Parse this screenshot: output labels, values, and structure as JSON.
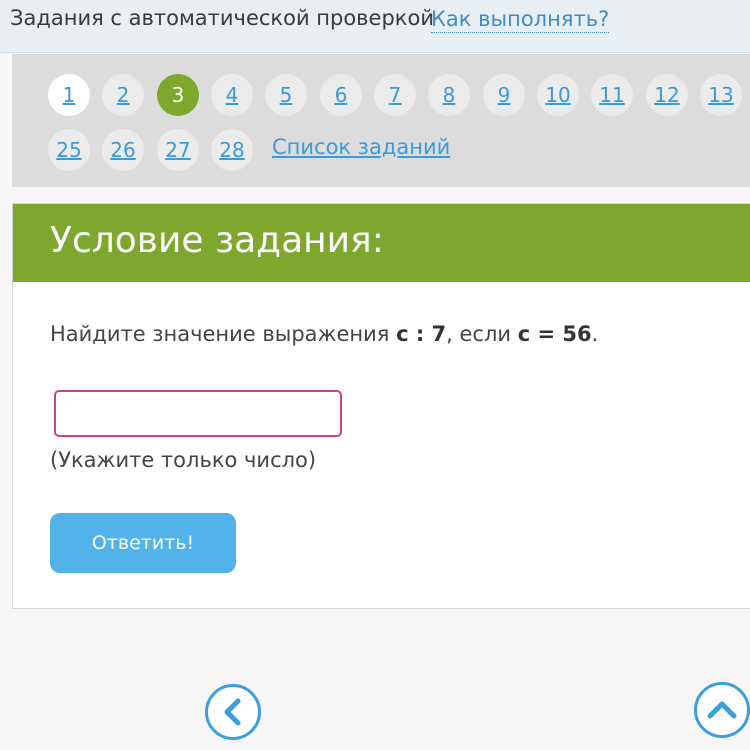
{
  "header": {
    "title": "Задания с автоматической проверкой",
    "howto_link": "Как выполнять?"
  },
  "nav": {
    "row1": [
      {
        "label": "1",
        "state": "visited"
      },
      {
        "label": "2",
        "state": "default"
      },
      {
        "label": "3",
        "state": "active"
      },
      {
        "label": "4",
        "state": "default"
      },
      {
        "label": "5",
        "state": "default"
      },
      {
        "label": "6",
        "state": "default"
      },
      {
        "label": "7",
        "state": "default"
      },
      {
        "label": "8",
        "state": "default"
      },
      {
        "label": "9",
        "state": "default"
      },
      {
        "label": "10",
        "state": "default"
      },
      {
        "label": "11",
        "state": "default"
      },
      {
        "label": "12",
        "state": "default"
      },
      {
        "label": "13",
        "state": "default"
      }
    ],
    "row2": [
      {
        "label": "25",
        "state": "default"
      },
      {
        "label": "26",
        "state": "default"
      },
      {
        "label": "27",
        "state": "default"
      },
      {
        "label": "28",
        "state": "default"
      }
    ],
    "task_list_link": "Список заданий"
  },
  "task": {
    "heading": "Условие задания:",
    "question_prefix": "Найдите значение выражения ",
    "expression": "с : 7",
    "question_middle": ", если ",
    "condition": "с = 56",
    "question_suffix": ".",
    "answer_value": "",
    "hint": "(Укажите только число)",
    "submit_label": "Ответить!"
  },
  "colors": {
    "accent_green": "#7ea72e",
    "link_blue": "#3c9ad6",
    "button_blue": "#52b3ea",
    "input_border": "#c8438e"
  },
  "icons": {
    "prev": "chevron-left-icon",
    "up": "chevron-up-icon"
  }
}
